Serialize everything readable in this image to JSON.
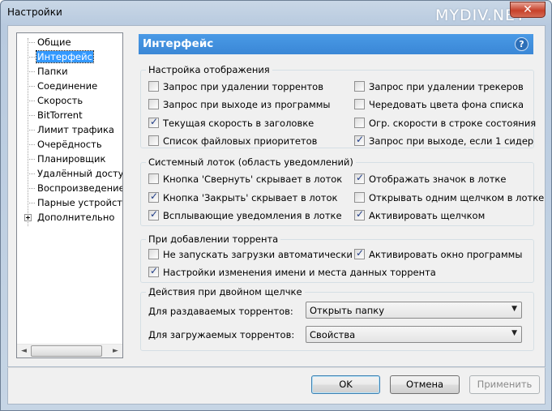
{
  "window": {
    "title": "Настройки",
    "watermark": "MYDIV.NET",
    "close_label": "✕"
  },
  "tree": {
    "items": [
      {
        "label": "Общие"
      },
      {
        "label": "Интерфейс"
      },
      {
        "label": "Папки"
      },
      {
        "label": "Соединение"
      },
      {
        "label": "Скорость"
      },
      {
        "label": "BitTorrent"
      },
      {
        "label": "Лимит трафика"
      },
      {
        "label": "Очерёдность"
      },
      {
        "label": "Планировщик"
      },
      {
        "label": "Удалённый доступ"
      },
      {
        "label": "Воспроизведение"
      },
      {
        "label": "Парные устройства"
      },
      {
        "label": "Дополнительно"
      }
    ],
    "selected": "Интерфейс",
    "scroll_left": "◄",
    "scroll_right": "►"
  },
  "panel": {
    "title": "Интерфейс",
    "help": "?"
  },
  "display": {
    "title": "Настройка отображения",
    "left": [
      {
        "label": "Запрос при удалении торрентов",
        "checked": false
      },
      {
        "label": "Запрос при выходе из программы",
        "checked": false
      },
      {
        "label": "Текущая скорость в заголовке",
        "checked": true
      },
      {
        "label": "Список файловых приоритетов",
        "checked": false
      }
    ],
    "right": [
      {
        "label": "Запрос при удалении трекеров",
        "checked": false
      },
      {
        "label": "Чередовать цвета фона списка",
        "checked": false
      },
      {
        "label": "Огр. скорости в строке состояния",
        "checked": false
      },
      {
        "label": "Запрос при выходе, если 1 сидер",
        "checked": true
      }
    ]
  },
  "tray": {
    "title": "Системный лоток (область уведомлений)",
    "left": [
      {
        "label": "Кнопка 'Свернуть' скрывает в лоток",
        "checked": false
      },
      {
        "label": "Кнопка 'Закрыть' скрывает в лоток",
        "checked": true
      },
      {
        "label": "Всплывающие уведомления в лотке",
        "checked": true
      }
    ],
    "right": [
      {
        "label": "Отображать значок в лотке",
        "checked": true
      },
      {
        "label": "Открывать одним щелчком в лотке",
        "checked": false
      },
      {
        "label": "Активировать щелчком",
        "checked": true
      }
    ]
  },
  "adding": {
    "title": "При добавлении торрента",
    "no_autostart": {
      "label": "Не запускать загрузки автоматически",
      "checked": false
    },
    "activate_window": {
      "label": "Активировать окно программы",
      "checked": true
    },
    "rename_dialog": {
      "label": "Настройки изменения имени и места данных торрента",
      "checked": true
    }
  },
  "double_click": {
    "title": "Действия при двойном щелчке",
    "seeding_label": "Для раздаваемых торрентов:",
    "seeding_value": "Открыть папку",
    "downloading_label": "Для загружаемых торрентов:",
    "downloading_value": "Свойства"
  },
  "buttons": {
    "ok": "OK",
    "cancel": "Отмена",
    "apply": "Применить"
  }
}
